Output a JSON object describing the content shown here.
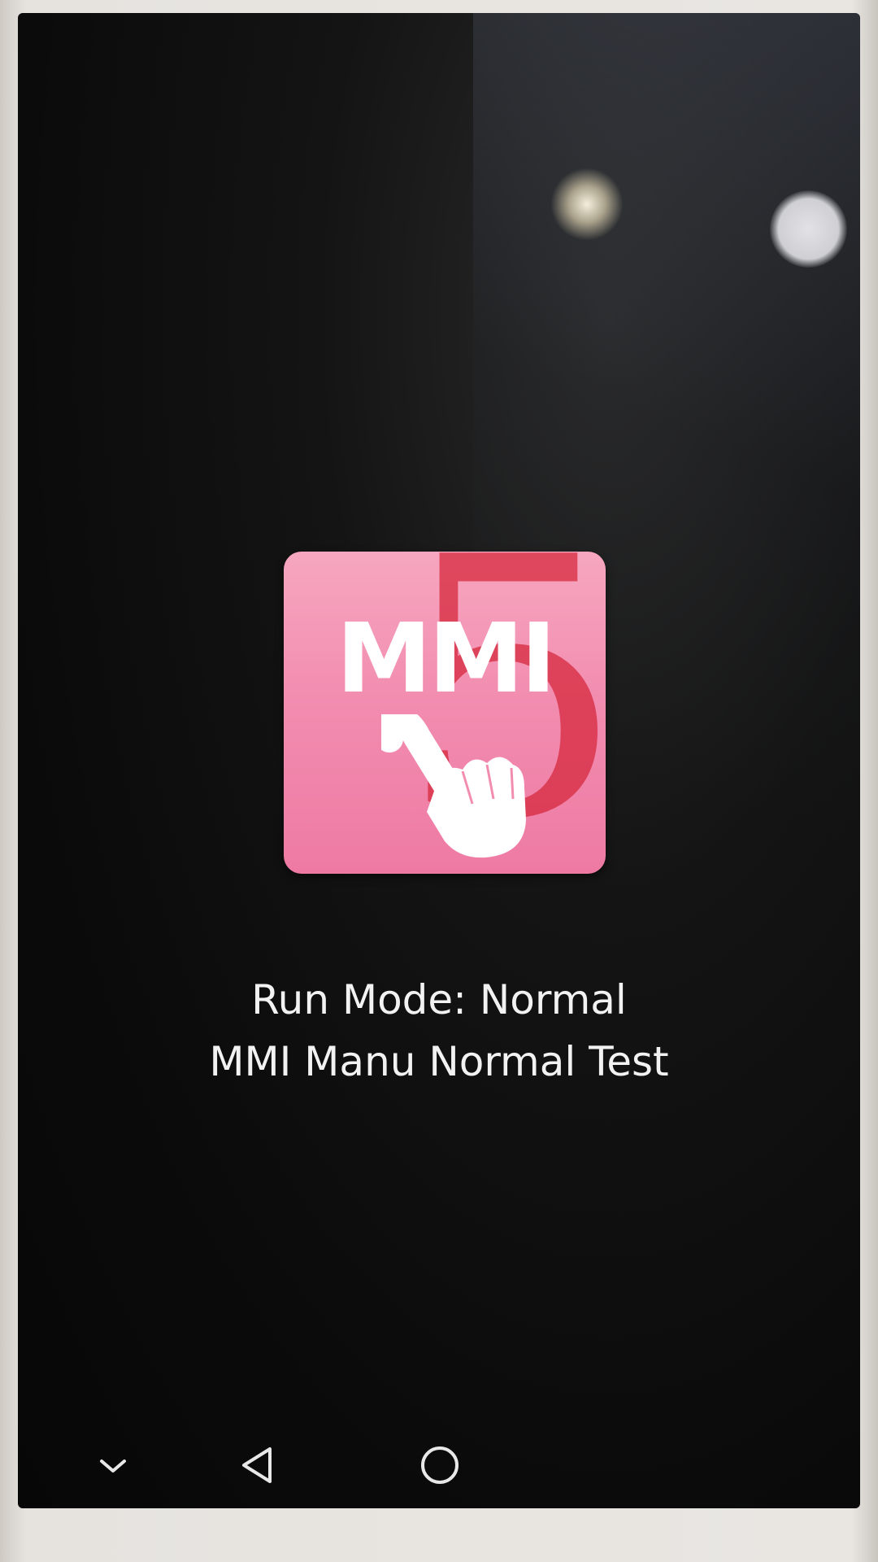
{
  "app_icon": {
    "label": "MMI",
    "badge": "5",
    "icon_name": "mmi-touch-hand-icon",
    "colors": {
      "background": "#f28db0",
      "badge": "#d6283c",
      "foreground": "#ffffff"
    }
  },
  "status": {
    "run_mode": "Run Mode: Normal",
    "test_name": "MMI Manu Normal Test"
  },
  "navbar": {
    "icons": [
      "chevron-down-icon",
      "back-icon",
      "home-icon"
    ]
  }
}
